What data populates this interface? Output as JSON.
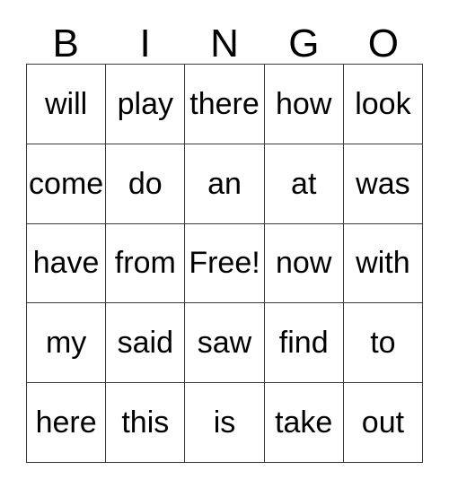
{
  "card": {
    "title": "BINGO",
    "header_letters": [
      "B",
      "I",
      "N",
      "G",
      "O"
    ],
    "free_space_label": "Free!",
    "free_space_position": {
      "row": 2,
      "col": 2
    },
    "grid_size": "5x5",
    "colors": {
      "background": "#ffffff",
      "text": "#000000",
      "border": "#3a3a3a"
    },
    "rows": [
      {
        "cells": [
          "will",
          "play",
          "there",
          "how",
          "look"
        ]
      },
      {
        "cells": [
          "come",
          "do",
          "an",
          "at",
          "was"
        ]
      },
      {
        "cells": [
          "have",
          "from",
          "Free!",
          "now",
          "with"
        ]
      },
      {
        "cells": [
          "my",
          "said",
          "saw",
          "find",
          "to"
        ]
      },
      {
        "cells": [
          "here",
          "this",
          "is",
          "take",
          "out"
        ]
      }
    ]
  }
}
